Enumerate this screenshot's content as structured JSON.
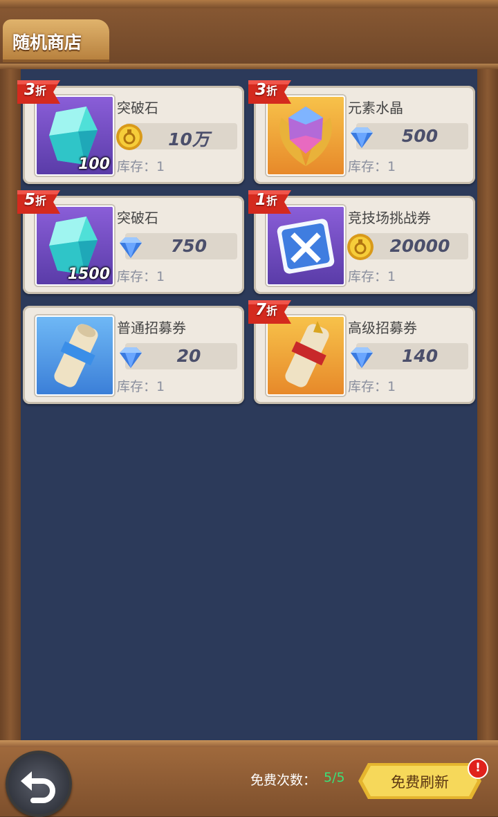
{
  "shop": {
    "title": "随机商店"
  },
  "items": [
    {
      "name": "突破石",
      "quantity": "100",
      "price": "10万",
      "currency": "gold-coin",
      "stock": "库存：1",
      "discount": "3",
      "discount_suffix": "折",
      "icon": "breakthrough-stone-icon"
    },
    {
      "name": "元素水晶",
      "quantity": "",
      "price": "500",
      "currency": "diamond",
      "stock": "库存：1",
      "discount": "3",
      "discount_suffix": "折",
      "icon": "element-crystal-icon"
    },
    {
      "name": "突破石",
      "quantity": "1500",
      "price": "750",
      "currency": "diamond",
      "stock": "库存：1",
      "discount": "5",
      "discount_suffix": "折",
      "icon": "breakthrough-stone-icon"
    },
    {
      "name": "竞技场挑战券",
      "quantity": "",
      "price": "20000",
      "currency": "gold-coin",
      "stock": "库存：1",
      "discount": "1",
      "discount_suffix": "折",
      "icon": "arena-ticket-icon"
    },
    {
      "name": "普通招募券",
      "quantity": "",
      "price": "20",
      "currency": "diamond",
      "stock": "库存：1",
      "discount": "",
      "discount_suffix": "",
      "icon": "normal-recruit-scroll-icon"
    },
    {
      "name": "高级招募券",
      "quantity": "",
      "price": "140",
      "currency": "diamond",
      "stock": "库存：1",
      "discount": "7",
      "discount_suffix": "折",
      "icon": "advanced-recruit-scroll-icon"
    }
  ],
  "footer": {
    "free_label": "免费次数：",
    "free_count": "5/5",
    "refresh_label": "免费刷新",
    "alert": "!"
  },
  "colors": {
    "panel": "#2c3a5a",
    "frame": "#8a5a34",
    "badge": "#d42a1e",
    "free_count": "#39e27a",
    "button": "#f6d24b"
  }
}
